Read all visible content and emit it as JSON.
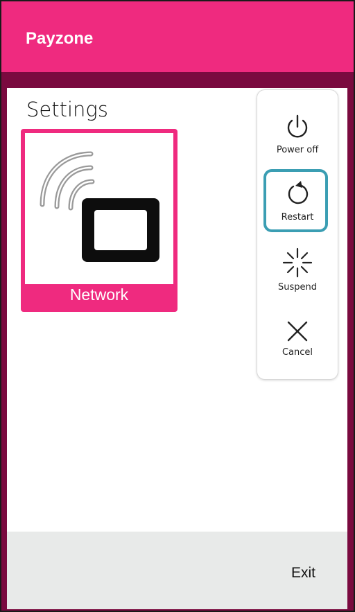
{
  "app": {
    "title": "Payzone"
  },
  "settings": {
    "title": "Settings",
    "tiles": [
      {
        "label": "Network",
        "icon": "contactless-card-icon"
      }
    ]
  },
  "footer": {
    "exit_label": "Exit"
  },
  "power_menu": {
    "items": [
      {
        "label": "Power off",
        "icon": "power-icon"
      },
      {
        "label": "Restart",
        "icon": "restart-icon",
        "focused": true
      },
      {
        "label": "Suspend",
        "icon": "suspend-icon"
      },
      {
        "label": "Cancel",
        "icon": "close-icon"
      }
    ]
  },
  "colors": {
    "brand": "#ef2a7f",
    "backdrop": "#7a0a3f",
    "focus": "#3b9eb3",
    "footer": "#e8eae9"
  }
}
